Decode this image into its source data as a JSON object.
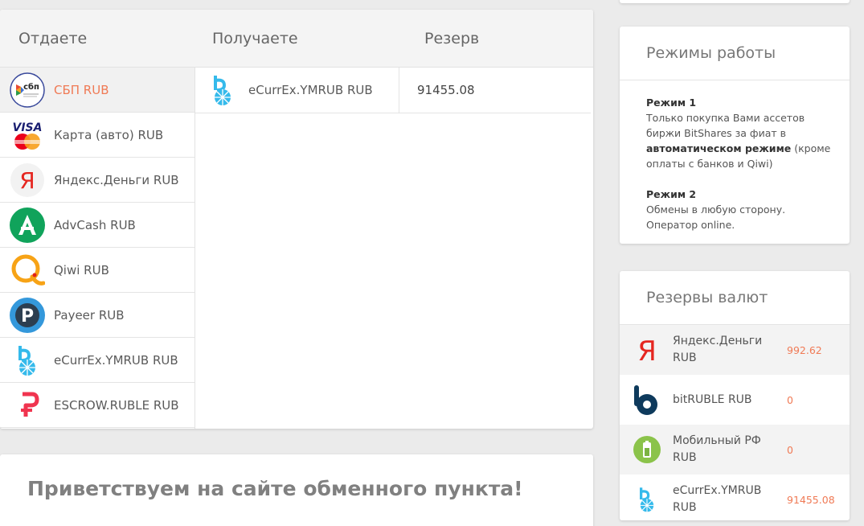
{
  "exchange": {
    "headers": {
      "give": "Отдаете",
      "get": "Получаете",
      "reserve": "Резерв"
    },
    "give_items": [
      {
        "label": "СБП RUB",
        "icon": "sbp-icon",
        "badge": "сбп",
        "active": true
      },
      {
        "label": "Карта (авто) RUB",
        "icon": "visa-mastercard-icon",
        "badge": "VISA"
      },
      {
        "label": "Яндекс.Деньги RUB",
        "icon": "yandex-money-icon",
        "badge": "Я"
      },
      {
        "label": "AdvCash RUB",
        "icon": "advcash-icon"
      },
      {
        "label": "Qiwi RUB",
        "icon": "qiwi-icon"
      },
      {
        "label": "Payeer RUB",
        "icon": "payeer-icon",
        "badge": "P"
      },
      {
        "label": "eCurrEx.YMRUB RUB",
        "icon": "bitshares-icon"
      },
      {
        "label": "ESCROW.RUBLE RUB",
        "icon": "escrow-icon"
      }
    ],
    "get_item": {
      "label": "eCurrEx.YMRUB RUB",
      "icon": "bitshares-icon",
      "reserve": "91455.08"
    }
  },
  "welcome": {
    "title": "Приветствуем на сайте обменного пункта!"
  },
  "modes": {
    "title": "Режимы работы",
    "mode1_title": "Режим 1",
    "mode1_text_a": "Только покупка Вами ассетов биржи BitShares за фиат в ",
    "mode1_bold": "автоматическом режиме",
    "mode1_text_b": " (кроме оплаты с банков и Qiwi)",
    "mode2_title": "Режим 2",
    "mode2_text": "Обмены в любую сторону. Оператор online."
  },
  "reserves": {
    "title": "Резервы валют",
    "items": [
      {
        "name": "Яндекс.Деньги RUB",
        "amount": "992.62",
        "icon": "yandex-money-icon",
        "badge": "Я"
      },
      {
        "name": "bitRUBLE RUB",
        "amount": "0",
        "icon": "bitruble-icon"
      },
      {
        "name": "Мобильный РФ RUB",
        "amount": "0",
        "icon": "mobile-battery-icon"
      },
      {
        "name": "eCurrEx.YMRUB RUB",
        "amount": "91455.08",
        "icon": "bitshares-icon"
      }
    ]
  },
  "colors": {
    "accent": "#f07a55",
    "yandex": "#e52620",
    "bitshares": "#35baeb",
    "payeer": "#3498db",
    "advcash": "#10a35b"
  }
}
